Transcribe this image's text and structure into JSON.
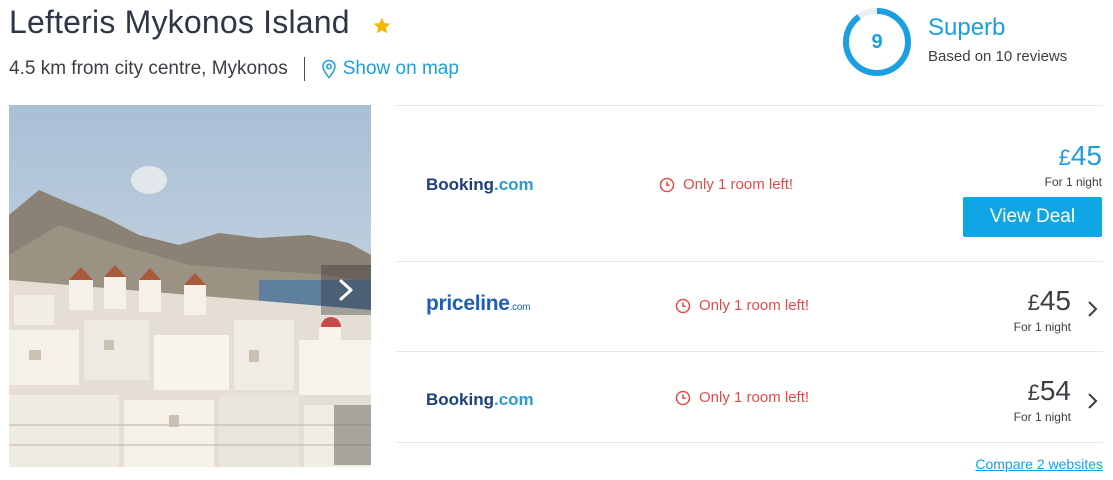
{
  "hotel": {
    "name": "Lefteris Mykonos Island",
    "distance": "4.5 km from city centre, Mykonos",
    "map_link": "Show on map"
  },
  "rating": {
    "score": "9",
    "label": "Superb",
    "reviews": "Based on 10 reviews",
    "score_fraction": 0.9
  },
  "deals": [
    {
      "provider": "Booking.com",
      "availability": "Only 1 room left!",
      "currency": "£",
      "price": "45",
      "per": "For 1 night",
      "button": "View Deal"
    },
    {
      "provider": "priceline.com",
      "availability": "Only 1 room left!",
      "currency": "£",
      "price": "45",
      "per": "For 1 night"
    },
    {
      "provider": "Booking.com",
      "availability": "Only 1 room left!",
      "currency": "£",
      "price": "54",
      "per": "For 1 night"
    }
  ],
  "compare_link": "Compare 2 websites",
  "logos": {
    "booking": {
      "name": "Booking",
      "suffix": ".com"
    },
    "priceline": {
      "name": "priceline",
      "suffix": ".com"
    }
  },
  "colors": {
    "accent": "#1a9fe0",
    "button": "#0fa6e6",
    "urgency": "#e34a4a",
    "star": "#f5b800"
  },
  "icons": {
    "star": "star-icon",
    "map": "map-pin-icon",
    "clock": "clock-icon",
    "next": "chevron-right-icon"
  }
}
